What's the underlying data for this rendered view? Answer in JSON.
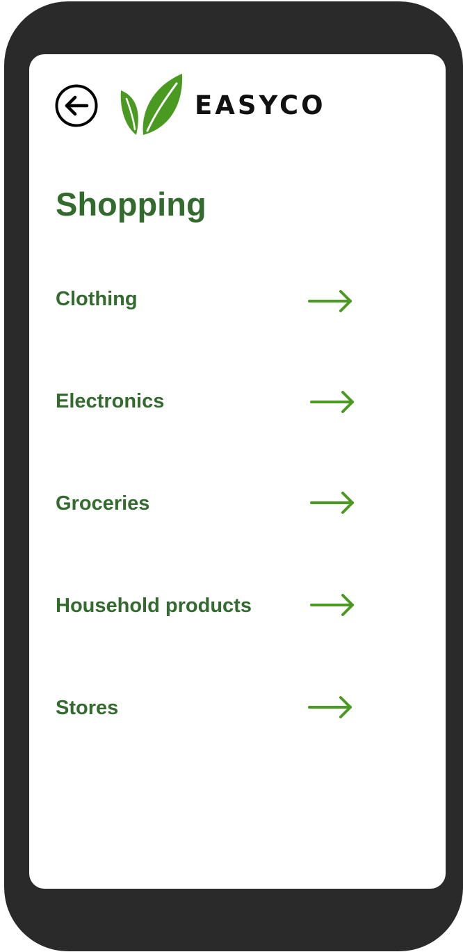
{
  "app": {
    "brand_name": "EASYCO",
    "logo_icon": "leaf-logo-icon",
    "brand_color": "#4a9a22"
  },
  "header": {
    "back_icon": "arrow-left-circle-icon"
  },
  "page": {
    "title": "Shopping",
    "title_color": "#336b2e"
  },
  "menu": {
    "items": [
      {
        "label": "Clothing",
        "icon": "arrow-right-icon"
      },
      {
        "label": "Electronics",
        "icon": "arrow-right-icon"
      },
      {
        "label": "Groceries",
        "icon": "arrow-right-icon"
      },
      {
        "label": "Household products",
        "icon": "arrow-right-icon"
      },
      {
        "label": "Stores",
        "icon": "arrow-right-icon"
      }
    ]
  }
}
